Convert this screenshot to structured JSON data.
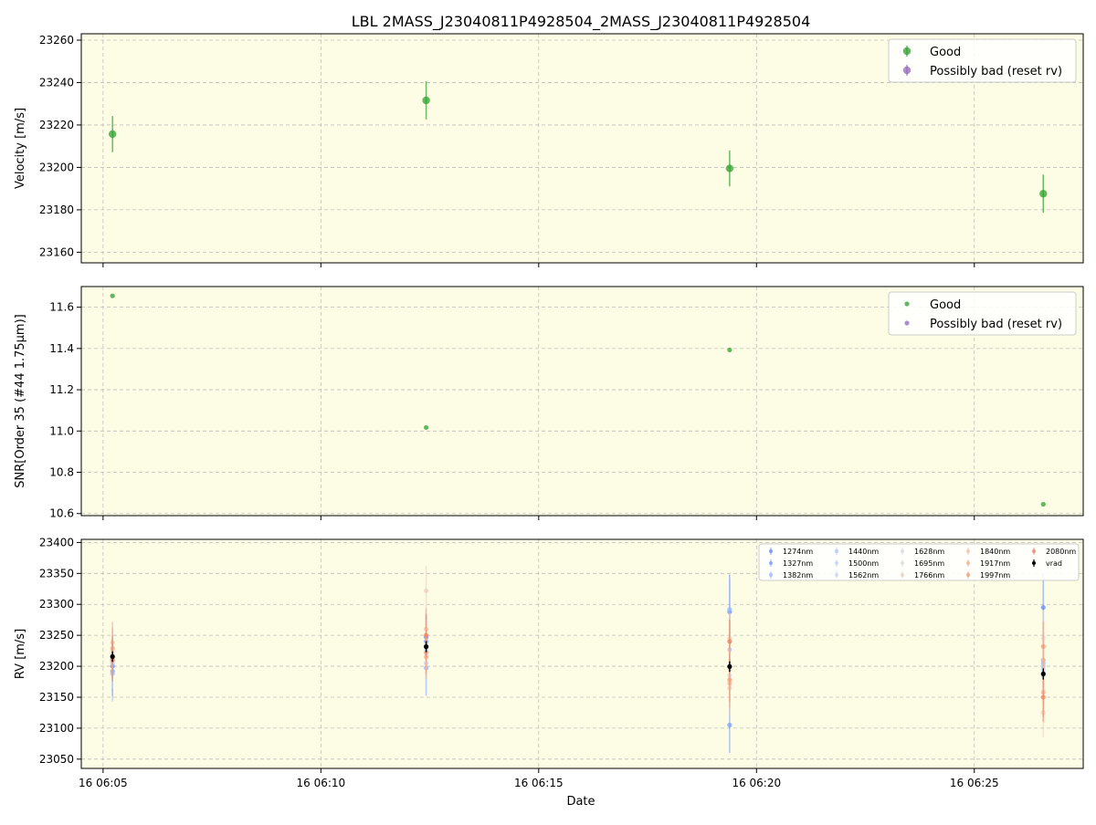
{
  "title": "LBL 2MASS_J23040811P4928504_2MASS_J23040811P4928504",
  "xlabel": "Date",
  "x_ticks": [
    "16 06:05",
    "16 06:10",
    "16 06:15",
    "16 06:20",
    "16 06:25"
  ],
  "colors": {
    "background": "#fdfde5",
    "good": "#2ca02c",
    "bad": "#9467bd",
    "grid": "#b0b0b0"
  },
  "chart_data": [
    {
      "type": "scatter",
      "name": "velocity",
      "ylabel": "Velocity [m/s]",
      "ylim": [
        23155,
        23263
      ],
      "yticks": [
        23160,
        23180,
        23200,
        23220,
        23240,
        23260
      ],
      "grid": true,
      "legend_placement": "top-right",
      "x_time": [
        "06:05:13",
        "06:12:25",
        "06:19:23",
        "06:26:35"
      ],
      "series": [
        {
          "name": "Good",
          "y": [
            23215.7,
            23231.6,
            23199.5,
            23187.6
          ],
          "yerr": [
            8.5,
            9.0,
            8.5,
            9.0
          ]
        },
        {
          "name": "Possibly bad (reset rv)",
          "y": [],
          "yerr": []
        }
      ]
    },
    {
      "type": "scatter",
      "name": "snr",
      "ylabel": "SNR[Order 35 (#44 1.75μm)]",
      "ylim": [
        10.59,
        11.7
      ],
      "yticks": [
        10.6,
        10.8,
        11.0,
        11.2,
        11.4,
        11.6
      ],
      "grid": true,
      "legend_placement": "top-right",
      "x_time": [
        "06:05:13",
        "06:12:25",
        "06:19:23",
        "06:26:35"
      ],
      "series": [
        {
          "name": "Good",
          "y": [
            11.655,
            11.017,
            11.393,
            10.645
          ]
        },
        {
          "name": "Possibly bad (reset rv)",
          "y": []
        }
      ]
    },
    {
      "type": "scatter",
      "name": "rv",
      "ylabel": "RV [m/s]",
      "ylim": [
        23035,
        23405
      ],
      "yticks": [
        23050,
        23100,
        23150,
        23200,
        23250,
        23300,
        23350,
        23400
      ],
      "grid": true,
      "legend_placement": "top-right",
      "legend_columns": 5,
      "x_time": [
        "06:05:13",
        "06:12:25",
        "06:19:23",
        "06:26:35"
      ],
      "series": [
        {
          "name": "1274nm",
          "color": "#6f8ff2",
          "y": [
            23200,
            23247,
            23288,
            23295
          ],
          "yerr": [
            40,
            45,
            60,
            55
          ]
        },
        {
          "name": "1327nm",
          "color": "#7b9ff9",
          "y": [
            23192,
            23240,
            23105,
            23210
          ],
          "yerr": [
            40,
            40,
            45,
            45
          ]
        },
        {
          "name": "1382nm",
          "color": "#9ab9ff",
          "y": [
            23188,
            23197,
            23292,
            23205
          ],
          "yerr": [
            45,
            45,
            50,
            50
          ]
        },
        {
          "name": "1440nm",
          "color": "#aec6fe",
          "y": [
            23205,
            23198,
            23227,
            23200
          ],
          "yerr": [
            45,
            45,
            60,
            55
          ]
        },
        {
          "name": "1500nm",
          "color": "#bcd2f8",
          "y": [
            23212,
            23205,
            23200,
            23195
          ],
          "yerr": [
            45,
            45,
            50,
            50
          ]
        },
        {
          "name": "1562nm",
          "color": "#c9d7f0",
          "y": [
            23208,
            23225,
            23185,
            23190
          ],
          "yerr": [
            45,
            45,
            50,
            50
          ]
        },
        {
          "name": "1628nm",
          "color": "#d8dce4",
          "y": [
            23218,
            23230,
            23240,
            23185
          ],
          "yerr": [
            40,
            40,
            45,
            45
          ]
        },
        {
          "name": "1695nm",
          "color": "#e4d9d2",
          "y": [
            23222,
            23235,
            23195,
            23245
          ],
          "yerr": [
            40,
            40,
            45,
            45
          ]
        },
        {
          "name": "1766nm",
          "color": "#eccfbf",
          "y": [
            23230,
            23322,
            23165,
            23125
          ],
          "yerr": [
            40,
            40,
            45,
            40
          ]
        },
        {
          "name": "1840nm",
          "color": "#f2c1a8",
          "y": [
            23238,
            23260,
            23245,
            23210
          ],
          "yerr": [
            35,
            35,
            40,
            40
          ]
        },
        {
          "name": "1917nm",
          "color": "#f5af92",
          "y": [
            23228,
            23215,
            23172,
            23158
          ],
          "yerr": [
            35,
            35,
            40,
            40
          ]
        },
        {
          "name": "1997nm",
          "color": "#f39b7b",
          "y": [
            23215,
            23222,
            23178,
            23232
          ],
          "yerr": [
            35,
            35,
            35,
            40
          ]
        },
        {
          "name": "2080nm",
          "color": "#ec8467",
          "y": [
            23210,
            23250,
            23240,
            23150
          ],
          "yerr": [
            35,
            35,
            35,
            40
          ]
        },
        {
          "name": "vrad",
          "color": "#000000",
          "y": [
            23215.7,
            23231.6,
            23199.5,
            23187.6
          ],
          "yerr": [
            8.5,
            9.0,
            8.5,
            9.0
          ]
        }
      ]
    }
  ]
}
